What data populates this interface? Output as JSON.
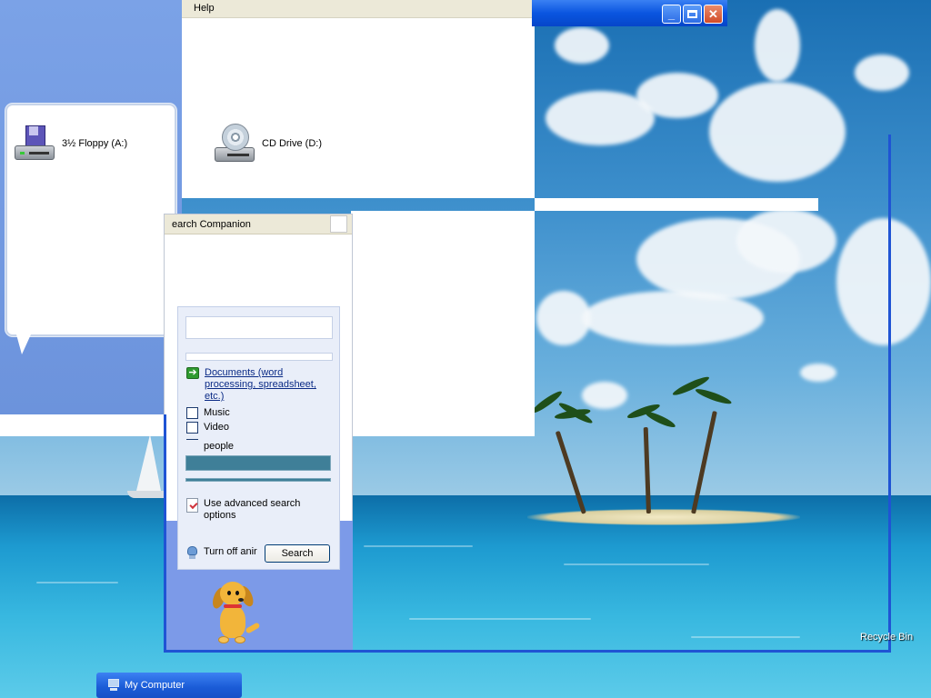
{
  "menubar": {
    "help_label": "Help"
  },
  "explorer": {
    "drives": [
      {
        "label": "3½ Floppy (A:)",
        "icon": "floppy-drive-icon"
      },
      {
        "label": "CD Drive (D:)",
        "icon": "cd-drive-icon"
      }
    ]
  },
  "search_companion": {
    "title": "earch Companion",
    "options": {
      "documents_label": "Documents (word processing, spreadsheet, etc.)",
      "music_label": "Music",
      "video_label": "Video",
      "people_label": "people"
    },
    "advanced_label": "Use advanced search options",
    "turn_off_label": "Turn off anir",
    "search_button": "Search"
  },
  "desktop": {
    "recycle_bin_label": "Recycle Bin"
  },
  "taskbar": {
    "my_computer_label": "My Computer"
  },
  "colors": {
    "xp_blue": "#1f54d4",
    "pane_blue": "#7ba2e7",
    "card_bg": "#e9eef9",
    "link": "#0b2b86"
  }
}
